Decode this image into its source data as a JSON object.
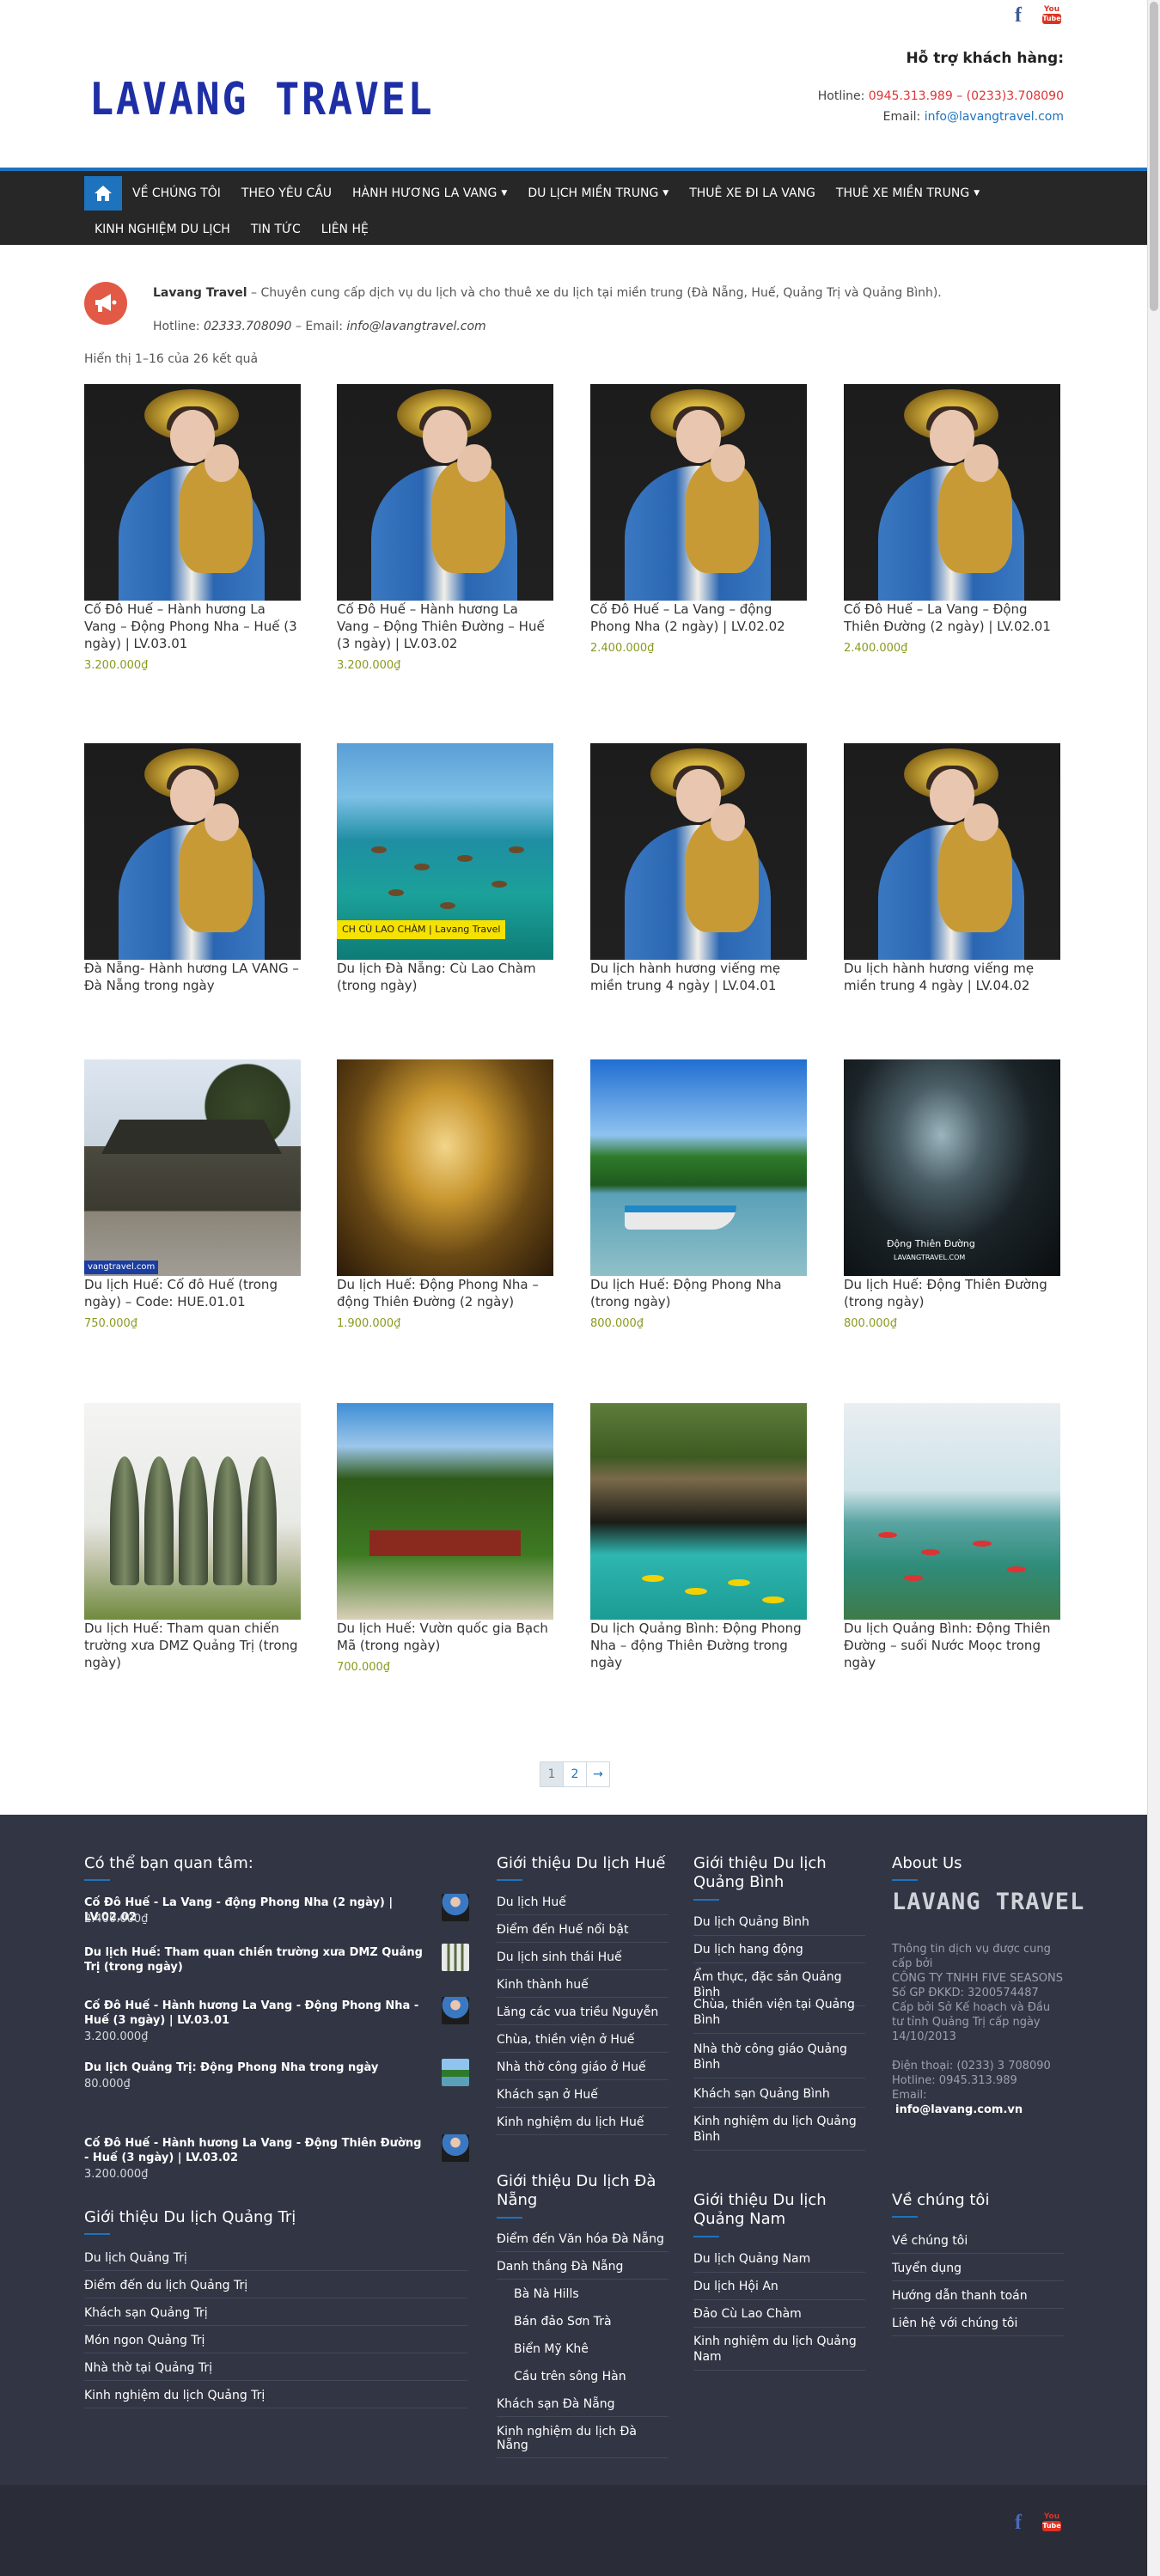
{
  "header": {
    "logo": "LAVANG TRAVEL",
    "support_title": "Hỗ trợ khách hàng:",
    "hotline_label": "Hotline: ",
    "hotline_value": "0945.313.989 – (0233)3.708090",
    "email_label": "Email: ",
    "email_value": "info@lavangtravel.com"
  },
  "nav": {
    "row1": [
      {
        "label": "VỀ CHÚNG TÔI",
        "caret": false
      },
      {
        "label": "THEO YÊU CẦU",
        "caret": false
      },
      {
        "label": "HÀNH HƯƠNG LA VANG",
        "caret": true
      },
      {
        "label": "DU LỊCH MIỀN TRUNG",
        "caret": true
      },
      {
        "label": "THUÊ XE ĐI LA VANG",
        "caret": false
      },
      {
        "label": "THUÊ XE MIỀN TRUNG",
        "caret": true
      }
    ],
    "row2": [
      {
        "label": "KINH NGHIỆM DU LỊCH"
      },
      {
        "label": "TIN TỨC"
      },
      {
        "label": "LIÊN HỆ"
      }
    ]
  },
  "notice": {
    "brand": "Lavang Travel",
    "text": " – Chuyên cung cấp dịch vụ du lịch và cho thuê xe du lịch tại miền trung (Đà Nẵng, Huế, Quảng Trị và Quảng Bình).",
    "hotline_label": "Hotline: ",
    "hotline": "02333.708090",
    "email_label": " – Email: ",
    "email": "info@lavangtravel.com"
  },
  "result_count": "Hiển thị 1–16 của 26 kết quả",
  "products": [
    {
      "title": "Cố Đô Huế – Hành hương La Vang – Động Phong Nha – Huế (3 ngày) | LV.03.01",
      "price": "3.200.000₫",
      "img": "mary"
    },
    {
      "title": "Cố Đô Huế – Hành hương La Vang – Động Thiên Đường – Huế (3 ngày) | LV.03.02",
      "price": "3.200.000₫",
      "img": "mary"
    },
    {
      "title": "Cố Đô Huế – La Vang – động Phong Nha (2 ngày) | LV.02.02",
      "price": "2.400.000₫",
      "img": "mary"
    },
    {
      "title": "Cố Đô Huế – La Vang – Động Thiên Đường (2 ngày) | LV.02.01",
      "price": "2.400.000₫",
      "img": "mary"
    },
    {
      "title": "Đà Nẵng- Hành hương LA VANG – Đà Nẵng trong ngày",
      "price": "",
      "img": "mary"
    },
    {
      "title": "Du lịch Đà Nẵng: Cù Lao Chàm (trong ngày)",
      "price": "",
      "img": "sea",
      "caption": "CH CÙ LAO CHÀM | Lavang Travel"
    },
    {
      "title": "Du lịch hành hương viếng mẹ miền trung 4 ngày | LV.04.01",
      "price": "",
      "img": "mary"
    },
    {
      "title": "Du lịch hành hương viếng mẹ miền trung 4 ngày | LV.04.02",
      "price": "",
      "img": "mary"
    },
    {
      "title": "Du lịch Huế: Cố đô Huế (trong ngày) – Code: HUE.01.01",
      "price": "750.000₫",
      "img": "hue",
      "caption": "vangtravel.com"
    },
    {
      "title": "Du lịch Huế: Động Phong Nha – động Thiên Đường (2 ngày)",
      "price": "1.900.000₫",
      "img": "cave"
    },
    {
      "title": "Du lịch Huế: Động Phong Nha (trong ngày)",
      "price": "800.000₫",
      "img": "river"
    },
    {
      "title": "Du lịch Huế: Động Thiên Đường (trong ngày)",
      "price": "800.000₫",
      "img": "dark",
      "caption": "Động Thiên Đường",
      "caption2": "LAVANGTRAVEL.COM"
    },
    {
      "title": "Du lịch Huế: Tham quan chiến trường xưa DMZ Quảng Trị (trong ngày)",
      "price": "",
      "img": "dmz"
    },
    {
      "title": "Du lịch Huế: Vườn quốc gia Bạch Mã (trong ngày)",
      "price": "700.000₫",
      "img": "bach"
    },
    {
      "title": "Du lịch Quảng Bình: Động Phong Nha – động Thiên Đường trong ngày",
      "price": "",
      "img": "pnk"
    },
    {
      "title": "Du lịch Quảng Bình: Động Thiên Đường – suối Nước Moọc trong ngày",
      "price": "",
      "img": "zip"
    }
  ],
  "pagination": {
    "current": "1",
    "next_page": "2",
    "arrow": "→"
  },
  "footer": {
    "interest_title": "Có thể bạn quan tâm:",
    "interest": [
      {
        "title": "Cố Đô Huế - La Vang - động Phong Nha (2 ngày) | LV.02.02",
        "price": "2.400.000₫",
        "thumb": "mary"
      },
      {
        "title": "Du lịch Huế: Tham quan chiến trường xưa DMZ Quảng Trị (trong ngày)",
        "price": "",
        "thumb": "dmz"
      },
      {
        "title": "Cố Đô Huế - Hành hương La Vang - Động Phong Nha - Huế (3 ngày) | LV.03.01",
        "price": "3.200.000₫",
        "thumb": "mary"
      },
      {
        "title": "Du lịch Quảng Trị: Động Phong Nha trong ngày",
        "price": "80.000₫",
        "thumb": "river"
      },
      {
        "title": "Cố Đô Huế - Hành hương La Vang - Động Thiên Đường - Huế (3 ngày) | LV.03.02",
        "price": "3.200.000₫",
        "thumb": "mary"
      }
    ],
    "quangtri_title": "Giới thiệu Du lịch Quảng Trị",
    "quangtri": [
      "Du lịch Quảng Trị",
      "Điểm đến du lịch Quảng Trị",
      "Khách sạn Quảng Trị",
      "Món ngon Quảng Trị",
      "Nhà thờ tại Quảng Trị",
      "Kinh nghiệm du lịch Quảng Trị"
    ],
    "hue_title": "Giới thiệu Du lịch Huế",
    "hue": [
      "Du lịch Huế",
      "Điểm đến Huế nổi bật",
      "Du lịch sinh thái Huế",
      "Kinh thành huế",
      "Lăng các vua triều Nguyễn",
      "Chùa, thiền viện ở Huế",
      "Nhà thờ công giáo ở Huế",
      "Khách sạn ở Huế",
      "Kinh nghiệm du lịch Huế"
    ],
    "danang_title": "Giới thiệu Du lịch Đà Nẵng",
    "danang": [
      {
        "label": "Điểm đến Văn hóa Đà Nẵng",
        "sub": false
      },
      {
        "label": "Danh thắng Đà Nẵng",
        "sub": false
      },
      {
        "label": "Bà Nà Hills",
        "sub": true
      },
      {
        "label": "Bán đảo Sơn Trà",
        "sub": true
      },
      {
        "label": "Biển Mỹ Khê",
        "sub": true
      },
      {
        "label": "Cầu trên sông Hàn",
        "sub": true
      },
      {
        "label": "Khách sạn Đà Nẵng",
        "sub": false
      },
      {
        "label": "Kinh nghiệm du lịch Đà Nẵng",
        "sub": false
      }
    ],
    "quangbinh_title": "Giới thiệu Du lịch Quảng Bình",
    "quangbinh": [
      "Du lịch Quảng Bình",
      "Du lịch hang động",
      "Ẩm thực, đặc sản Quảng Bình",
      "Chùa, thiền viện tại Quảng Bình",
      "Nhà thờ công giáo Quảng Bình",
      "Khách sạn Quảng Bình",
      "Kinh nghiệm du lịch Quảng Bình"
    ],
    "quangnam_title": "Giới thiệu Du lịch Quảng Nam",
    "quangnam": [
      "Du lịch Quảng Nam",
      "Du lịch Hội An",
      "Đảo Cù Lao Chàm",
      "Kinh nghiệm du lịch Quảng Nam"
    ],
    "about_title": "About Us",
    "about_logo": "LAVANG TRAVEL",
    "about_lines": [
      "Thông tin dịch vụ được cung cấp bởi",
      "CÔNG TY TNHH FIVE SEASONS",
      "Số GP ĐKKD: 3200574487 Cấp bởi Sở Kế hoạch và Đầu tư tỉnh Quảng Trị cấp ngày 14/10/2013"
    ],
    "about_phone": "Điện thoại: (0233) 3 708090",
    "about_hotline": "Hotline: 0945.313.989",
    "about_email_label": "Email:",
    "about_email": "info@lavang.com.vn",
    "us_title": "Về chúng tôi",
    "us": [
      "Về chúng tôi",
      "Tuyển dụng",
      "Hướng dẫn thanh toán",
      "Liên hệ với chúng tôi"
    ]
  },
  "colors": {
    "accent": "#1e73be",
    "nav_bg": "#272727",
    "footer_bg": "#323543",
    "price": "#8a9a1e",
    "hotline": "#dd3333"
  }
}
